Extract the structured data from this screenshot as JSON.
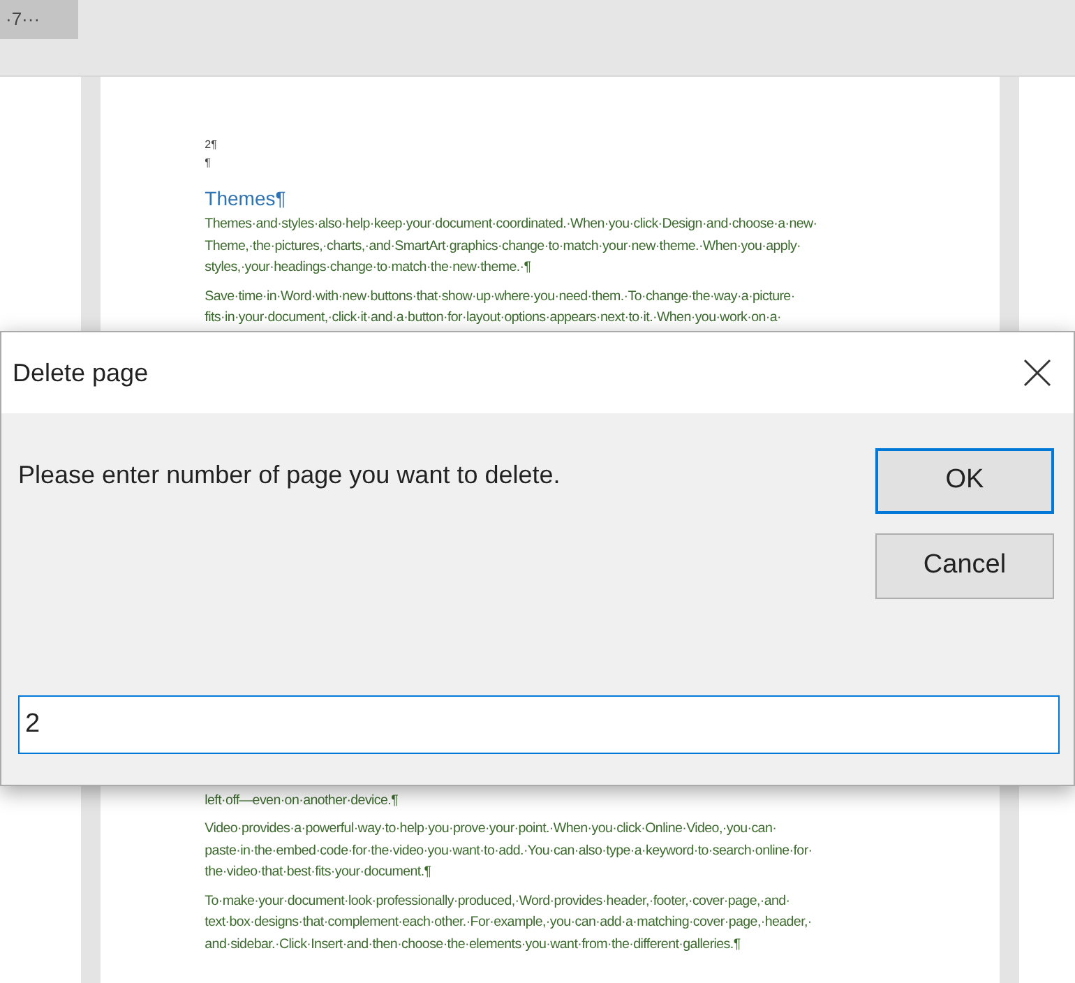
{
  "ruler": {
    "label": "·7···"
  },
  "document": {
    "top_lines": [
      "2¶",
      "¶"
    ],
    "heading": "Themes¶",
    "top_paragraphs": [
      [
        "Themes·and·styles·also·help·keep·your·document·coordinated.·When·you·click·Design·and·choose·a·new·",
        "Theme,·the·pictures,·charts,·and·SmartArt·graphics·change·to·match·your·new·theme.·When·you·apply·",
        "styles,·your·headings·change·to·match·the·new·theme.·¶"
      ],
      [
        "Save·time·in·Word·with·new·buttons·that·show·up·where·you·need·them.·To·change·the·way·a·picture·",
        "fits·in·your·document,·click·it·and·a·button·for·layout·options·appears·next·to·it.·When·you·work·on·a·"
      ]
    ],
    "bottom_paragraphs": [
      [
        "left·off—even·on·another·device.¶"
      ],
      [
        "Video·provides·a·powerful·way·to·help·you·prove·your·point.·When·you·click·Online·Video,·you·can·",
        "paste·in·the·embed·code·for·the·video·you·want·to·add.·You·can·also·type·a·keyword·to·search·online·for·",
        "the·video·that·best·fits·your·document.¶"
      ],
      [
        "To·make·your·document·look·professionally·produced,·Word·provides·header,·footer,·cover·page,·and·",
        "text·box·designs·that·complement·each·other.·For·example,·you·can·add·a·matching·cover·page,·header,·",
        "and·sidebar.·Click·Insert·and·then·choose·the·elements·you·want·from·the·different·galleries.¶"
      ]
    ]
  },
  "dialog": {
    "title": "Delete page",
    "message": "Please enter number of page you want to delete.",
    "input": {
      "value": "2"
    },
    "buttons": [
      {
        "label": "OK",
        "default": true
      },
      {
        "label": "Cancel",
        "default": false
      }
    ]
  }
}
